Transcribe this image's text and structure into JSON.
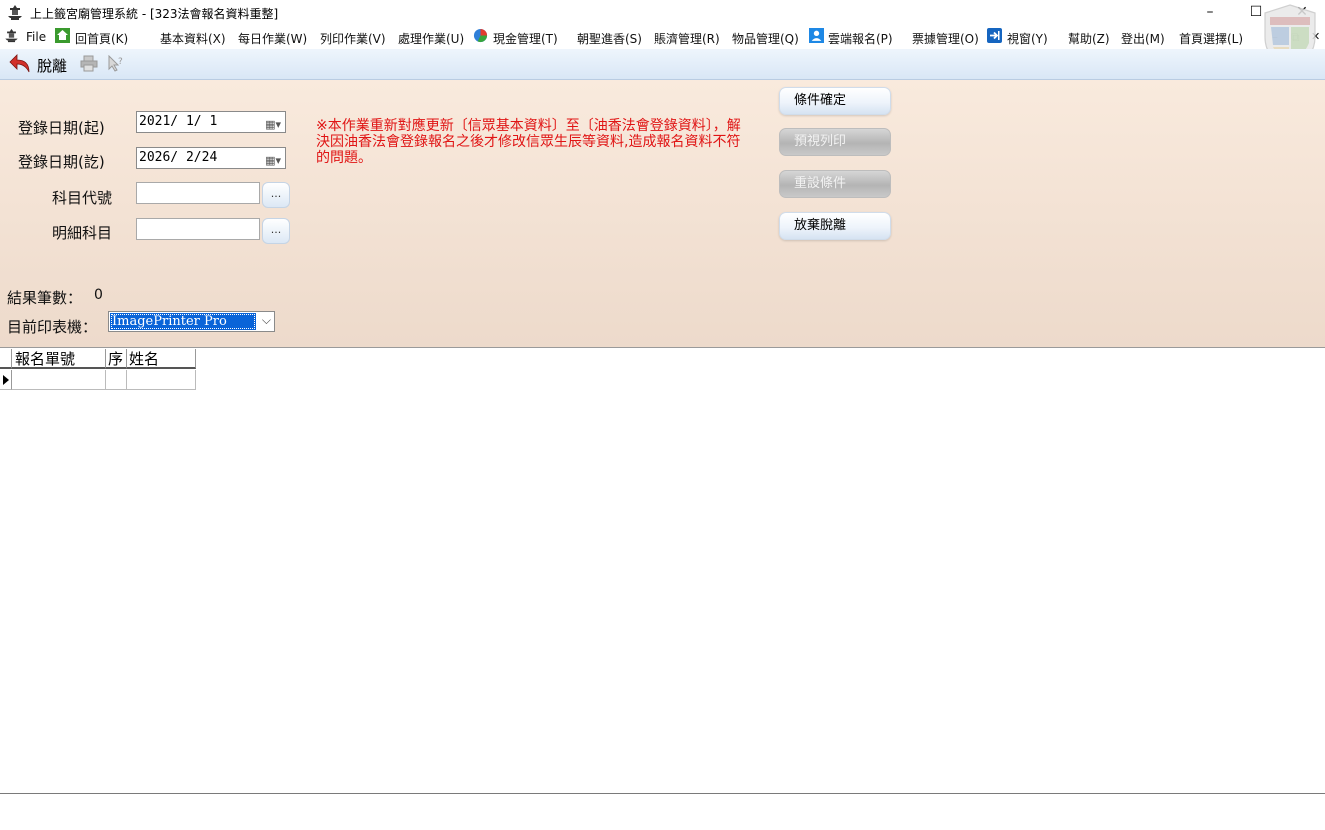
{
  "window": {
    "title": "上上籤宮廟管理系統 - [323法會報名資料重整]",
    "controls": {
      "minimize": "–",
      "maximize": "☐",
      "close": "✕"
    },
    "mdi_controls": {
      "minimize": "–",
      "restore": "⧉",
      "close": "✕"
    }
  },
  "menu": {
    "items": [
      "File",
      "回首頁(K)",
      "基本資料(X)",
      "每日作業(W)",
      "列印作業(V)",
      "處理作業(U)",
      "現金管理(T)",
      "朝聖進香(S)",
      "賬濟管理(R)",
      "物品管理(Q)",
      "雲端報名(P)",
      "票據管理(O)",
      "視窗(Y)",
      "幫助(Z)",
      "登出(M)",
      "首頁選擇(L)"
    ]
  },
  "toolbar": {
    "exit_label": "脫離",
    "icons": [
      "back-arrow-icon",
      "print-icon",
      "help-pointer-icon"
    ]
  },
  "form": {
    "date_start_label": "登錄日期(起)",
    "date_start_value": "2021/ 1/ 1",
    "date_end_label": "登錄日期(訖)",
    "date_end_value": "2026/ 2/24",
    "subject_code_label": "科目代號",
    "detail_subject_label": "明細科目",
    "browse_label": "...",
    "notice": "※本作業重新對應更新〔信眾基本資料〕至〔油香法會登錄資料〕，解決因油香法會登錄報名之後才修改信眾生辰等資料,造成報名資料不符的問題。",
    "result_label": "結果筆數：",
    "result_value": "0",
    "printer_label": "目前印表機：",
    "printer_value": "ImagePrinter Pro"
  },
  "buttons": {
    "confirm": "條件確定",
    "preview": "預視列印",
    "reset": "重設條件",
    "cancel_exit": "放棄脫離"
  },
  "grid": {
    "columns": [
      "報名單號",
      "序",
      "姓名"
    ]
  },
  "colors": {
    "notice": "#e01414",
    "panel_top": "#f9eadd",
    "panel_bottom": "#eddacb",
    "selection": "#0a64d8"
  }
}
